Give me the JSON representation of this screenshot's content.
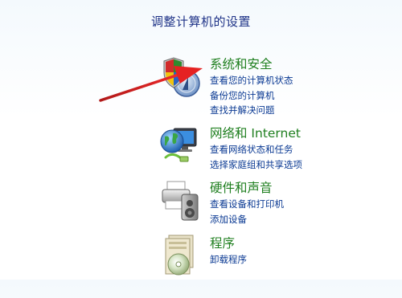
{
  "page": {
    "title": "调整计算机的设置"
  },
  "categories": [
    {
      "title": "系统和安全",
      "icon": "shield-security-icon",
      "links": [
        "查看您的计算机状态",
        "备份您的计算机",
        "查找并解决问题"
      ]
    },
    {
      "title": "网络和 Internet",
      "icon": "network-globe-icon",
      "links": [
        "查看网络状态和任务",
        "选择家庭组和共享选项"
      ]
    },
    {
      "title": "硬件和声音",
      "icon": "printer-speaker-icon",
      "links": [
        "查看设备和打印机",
        "添加设备"
      ]
    },
    {
      "title": "程序",
      "icon": "programs-disc-icon",
      "links": [
        "卸载程序"
      ]
    }
  ],
  "annotation": {
    "arrow_color": "#d91c1c"
  }
}
